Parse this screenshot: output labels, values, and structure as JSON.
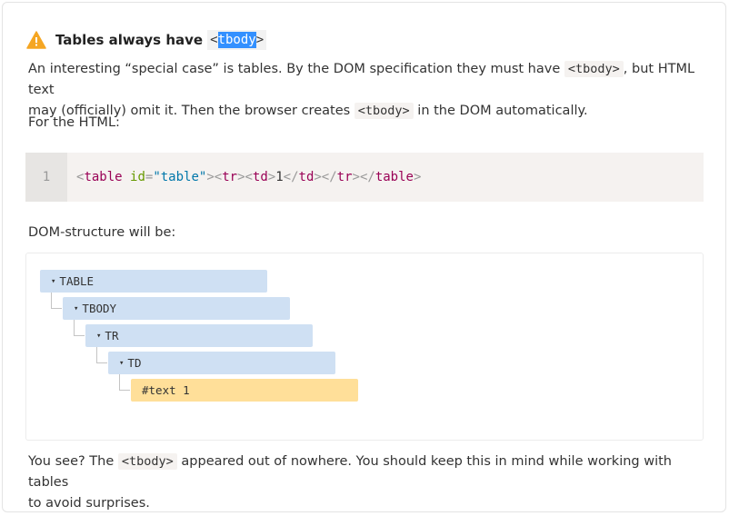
{
  "header": {
    "icon": "warning-icon",
    "title_text": "Tables always have",
    "title_code_open": "<",
    "title_code_selected": "tbody",
    "title_code_close": ">"
  },
  "intro": {
    "p1_a": "An interesting “special case” is tables. By the DOM specification they must have",
    "p1_code1": "<tbody>",
    "p1_b": ", but HTML text",
    "p1_c": "may (officially) omit it. Then the browser creates",
    "p1_code2": "<tbody>",
    "p1_d": "in the DOM automatically.",
    "p2": "For the HTML:"
  },
  "code": {
    "line_number": "1",
    "tokens": [
      {
        "t": "<",
        "c": "punct"
      },
      {
        "t": "table",
        "c": "tag"
      },
      {
        "t": " ",
        "c": "text"
      },
      {
        "t": "id",
        "c": "attr"
      },
      {
        "t": "=",
        "c": "punct"
      },
      {
        "t": "\"table\"",
        "c": "val"
      },
      {
        "t": "><",
        "c": "punct"
      },
      {
        "t": "tr",
        "c": "tag"
      },
      {
        "t": "><",
        "c": "punct"
      },
      {
        "t": "td",
        "c": "tag"
      },
      {
        "t": ">",
        "c": "punct"
      },
      {
        "t": "1",
        "c": "text"
      },
      {
        "t": "</",
        "c": "punct"
      },
      {
        "t": "td",
        "c": "tag"
      },
      {
        "t": "></",
        "c": "punct"
      },
      {
        "t": "tr",
        "c": "tag"
      },
      {
        "t": "></",
        "c": "punct"
      },
      {
        "t": "table",
        "c": "tag"
      },
      {
        "t": ">",
        "c": "punct"
      }
    ]
  },
  "dom_caption": "DOM-structure will be:",
  "dom_tree": {
    "nodes": [
      {
        "label": "TABLE",
        "kind": "element",
        "toggle": "▾"
      },
      {
        "label": "TBODY",
        "kind": "element",
        "toggle": "▾"
      },
      {
        "label": "TR",
        "kind": "element",
        "toggle": "▾"
      },
      {
        "label": "TD",
        "kind": "element",
        "toggle": "▾"
      },
      {
        "label": "#text 1",
        "kind": "text",
        "toggle": ""
      }
    ]
  },
  "outro": {
    "a": "You see? The",
    "code": "<tbody>",
    "b": "appeared out of nowhere. You should keep this in mind while working with tables",
    "c": "to avoid surprises."
  }
}
